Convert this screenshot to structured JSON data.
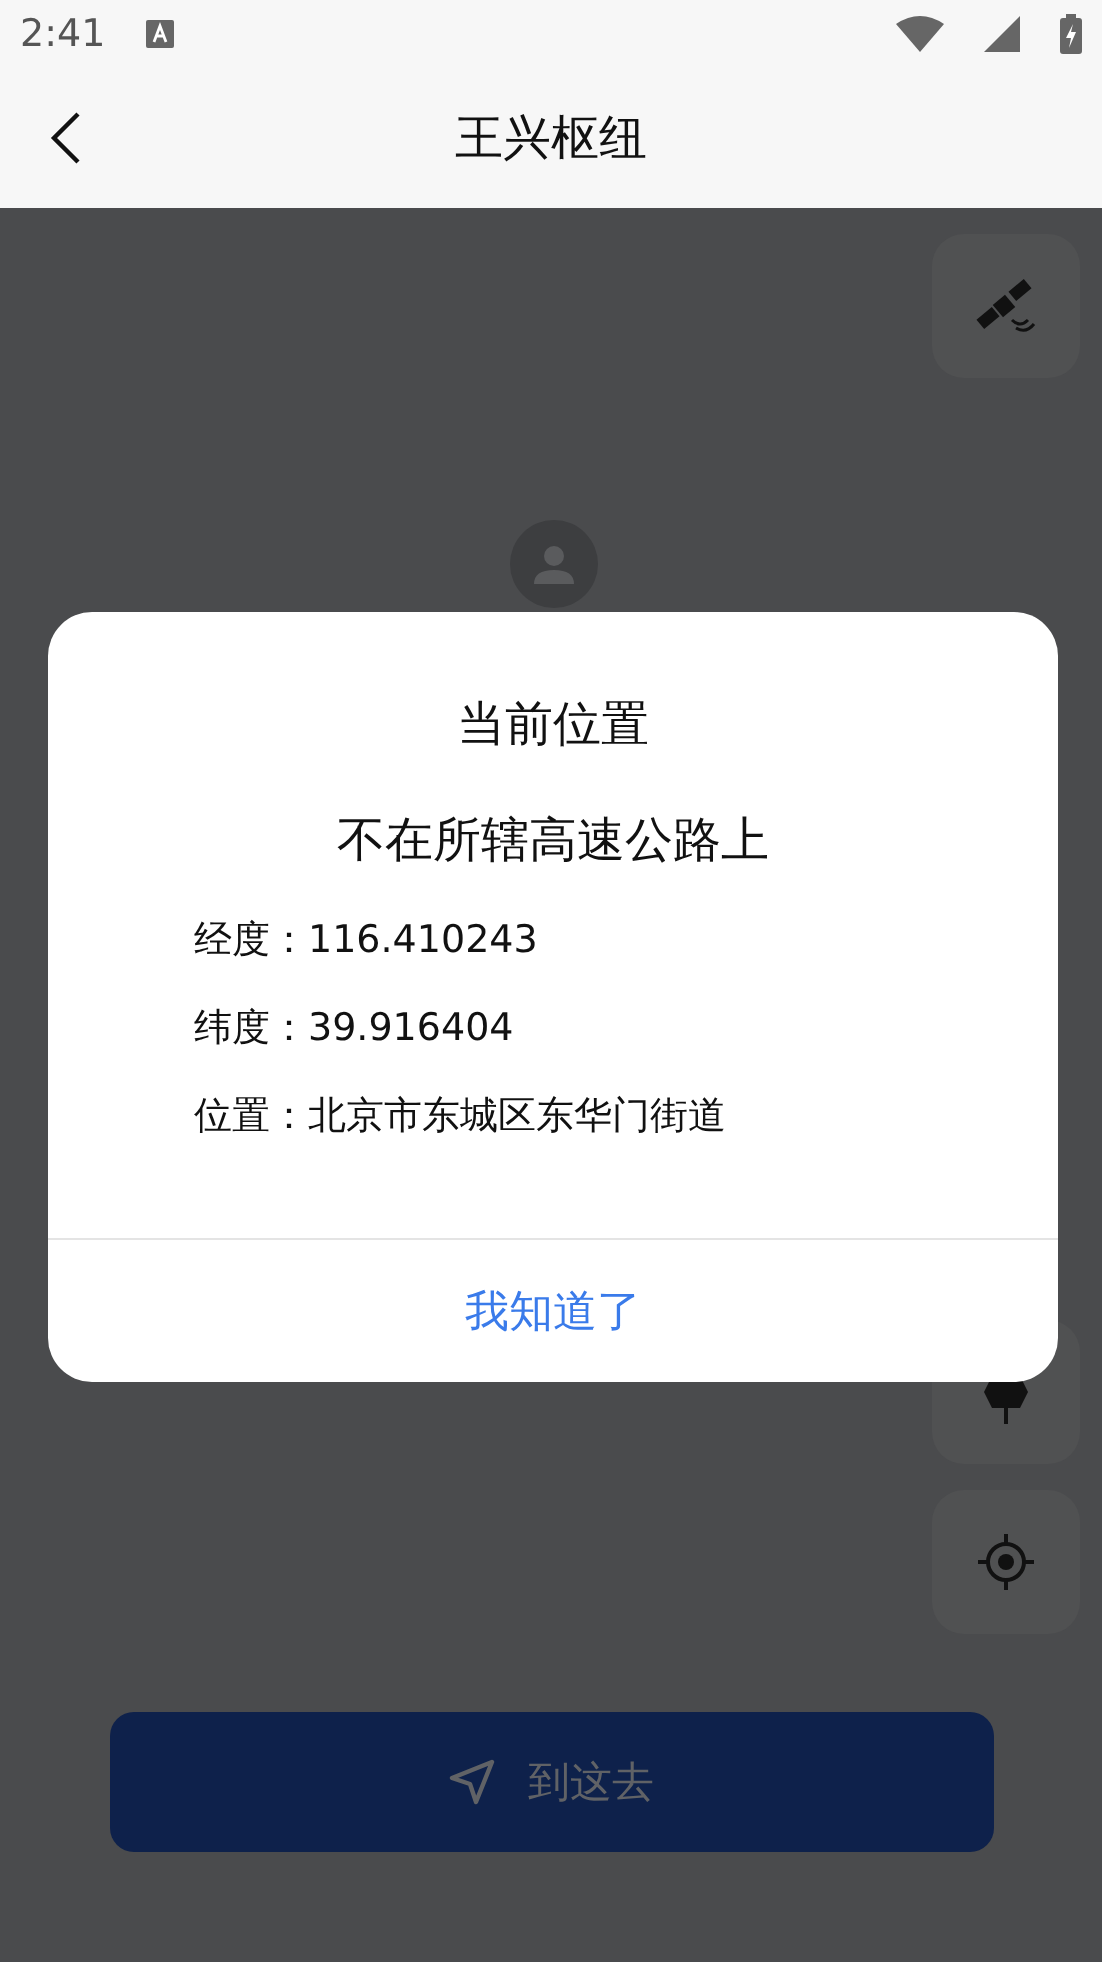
{
  "status_bar": {
    "time": "2:41"
  },
  "header": {
    "title": "王兴枢纽"
  },
  "dialog": {
    "title": "当前位置",
    "message": "不在所辖高速公路上",
    "fields": [
      {
        "label": "经度：",
        "value": "116.410243"
      },
      {
        "label": "纬度：",
        "value": "39.916404"
      },
      {
        "label": "位置：",
        "value": "北京市东城区东华门街道"
      }
    ],
    "confirm": "我知道了"
  },
  "navigate_button": {
    "label": "到这去"
  }
}
